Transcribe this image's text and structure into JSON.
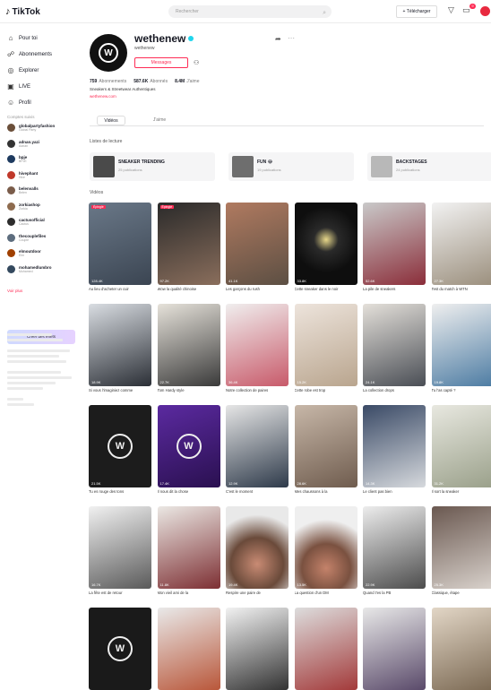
{
  "header": {
    "logo_text": "TikTok",
    "search_placeholder": "Rechercher",
    "upload_label": "+ Télécharger"
  },
  "sidebar": {
    "nav": [
      {
        "label": "Pour toi",
        "icon": "home-icon"
      },
      {
        "label": "Abonnements",
        "icon": "following-icon"
      },
      {
        "label": "Explorer",
        "icon": "compass-icon"
      },
      {
        "label": "LIVE",
        "icon": "live-icon"
      },
      {
        "label": "Profil",
        "icon": "profile-icon"
      }
    ],
    "following_heading": "Comptes suivis",
    "accounts": [
      {
        "name": "globalpartyfashion",
        "sub": "Global Party",
        "color": "#6b4f3a"
      },
      {
        "name": "adnan.yazi",
        "sub": "Adnan",
        "color": "#333"
      },
      {
        "name": "bpje",
        "sub": "BPJE",
        "color": "#1e3a5f"
      },
      {
        "name": "hivephant",
        "sub": "Hive",
        "color": "#c0392b"
      },
      {
        "name": "belenvalls",
        "sub": "Belen",
        "color": "#7a5c4a"
      },
      {
        "name": "zorkiashop",
        "sub": "Zorkia",
        "color": "#8e6b4e"
      },
      {
        "name": "cactusofficial",
        "sub": "Cactus",
        "color": "#2d2d2d"
      },
      {
        "name": "thecouplefiles",
        "sub": "Couple",
        "color": "#5d6d7e"
      },
      {
        "name": "elmoutdoor",
        "sub": "Elm",
        "color": "#a04000"
      },
      {
        "name": "mohamedlumbro",
        "sub": "Mohamed",
        "color": "#34495e"
      }
    ],
    "see_all": "Voir plus",
    "promo_label": "Créer des effets"
  },
  "profile": {
    "username": "wethenew",
    "nickname": "wethenew",
    "message_label": "Messages",
    "stats": [
      {
        "value": "759",
        "label": "Abonnements"
      },
      {
        "value": "587.6K",
        "label": "Abonnés"
      },
      {
        "value": "8.4M",
        "label": "J'aime"
      }
    ],
    "bio": "Sneakers & Streetwear Authentiques",
    "link": "wethenew.com",
    "tabs": {
      "videos": "Vidéos",
      "liked": "J'aime"
    }
  },
  "collections_title": "Listes de lecture",
  "collections": [
    {
      "name": "SNEAKER TRENDING",
      "count": "25 publications",
      "color": "#4a4a4a"
    },
    {
      "name": "FUN 😂",
      "count": "19 publications",
      "color": "#6e6e6e"
    },
    {
      "name": "BACKSTAGES",
      "count": "24 publications",
      "color": "#b8b8b8"
    }
  ],
  "videos_title": "Vidéos",
  "videos": [
    {
      "caption": "Au lieu d'acheter un cuir",
      "views": "128.4K",
      "bg": "linear-gradient(160deg,#6a7888,#3b4552)",
      "pin": "Épinglé",
      "logo": false
    },
    {
      "caption": "Wow la qualité chinoise",
      "views": "97.2K",
      "bg": "linear-gradient(160deg,#2a2a2a,#8a6e5c)",
      "pin": "Épinglé",
      "logo": false
    },
    {
      "caption": "Les garçons du rush",
      "views": "41.1K",
      "bg": "linear-gradient(160deg,#b07a60,#5c4f43)",
      "pin": "",
      "logo": false
    },
    {
      "caption": "Cette sneaker dans le noir",
      "views": "33.8K",
      "bg": "radial-gradient(circle at 50% 45%,#e8d88a 0,#2a2a2a 22%,#0e0e0e 60%)",
      "pin": "",
      "logo": false
    },
    {
      "caption": "La pile de sneakers",
      "views": "52.6K",
      "bg": "linear-gradient(160deg,#c9c9c9,#8b2e3a)",
      "pin": "",
      "logo": false
    },
    {
      "caption": "Test du match à WTN",
      "views": "27.3K",
      "bg": "linear-gradient(160deg,#f2f2f2,#9b8f7d)",
      "pin": "",
      "logo": false
    },
    {
      "caption": "Si vous l'imaginiez comme",
      "views": "18.9K",
      "bg": "linear-gradient(160deg,#d9dde2,#2b2f36)",
      "pin": "",
      "logo": false
    },
    {
      "caption": "Tom Hardy style",
      "views": "22.7K",
      "bg": "linear-gradient(160deg,#e6e2da,#3a3a3a)",
      "pin": "",
      "logo": false
    },
    {
      "caption": "Notre collection de paires",
      "views": "36.4K",
      "bg": "linear-gradient(160deg,#f0eeee,#c85a6a)",
      "pin": "",
      "logo": false
    },
    {
      "caption": "Cette robe est trop",
      "views": "15.2K",
      "bg": "linear-gradient(160deg,#ede4dc,#b9a58e)",
      "pin": "",
      "logo": false
    },
    {
      "caption": "La collection drops",
      "views": "24.1K",
      "bg": "linear-gradient(160deg,#e4e0da,#4a4e55)",
      "pin": "",
      "logo": false
    },
    {
      "caption": "Tu l'as capté ?",
      "views": "19.8K",
      "bg": "linear-gradient(160deg,#efefef,#4d7ca3)",
      "pin": "",
      "logo": false
    },
    {
      "caption": "Tu es rouge des tons",
      "views": "21.5K",
      "bg": "#1c1c1c",
      "pin": "",
      "logo": true
    },
    {
      "caption": "Il nous dit la chose",
      "views": "17.4K",
      "bg": "linear-gradient(160deg,#5b2aa0,#2a1050)",
      "pin": "",
      "logo": true
    },
    {
      "caption": "C'est le moment",
      "views": "12.9K",
      "bg": "linear-gradient(160deg,#e6e6e6,#2e3a4a)",
      "pin": "",
      "logo": false
    },
    {
      "caption": "Mes chaussons à la",
      "views": "28.6K",
      "bg": "linear-gradient(160deg,#c7b7a8,#6f5c4e)",
      "pin": "",
      "logo": false
    },
    {
      "caption": "Le client pas bien",
      "views": "14.3K",
      "bg": "linear-gradient(160deg,#3a4a66,#d6d9dd)",
      "pin": "",
      "logo": false
    },
    {
      "caption": "Il sort la sneaker",
      "views": "31.2K",
      "bg": "linear-gradient(160deg,#e8e8e0,#9aa08a)",
      "pin": "",
      "logo": false
    },
    {
      "caption": "La fête est de retour",
      "views": "16.7K",
      "bg": "linear-gradient(160deg,#f1f1f1,#5a5a5a)",
      "pin": "",
      "logo": false
    },
    {
      "caption": "Mon vieil ami de la",
      "views": "11.8K",
      "bg": "linear-gradient(160deg,#ebe8e4,#7d2f33)",
      "pin": "",
      "logo": false
    },
    {
      "caption": "Respire une paire de",
      "views": "19.4K",
      "bg": "radial-gradient(circle at 50% 70%,#c98b74 0,#6a4a3a 40%,#e9e9e9 75%)",
      "pin": "",
      "logo": false
    },
    {
      "caption": "La question d'un DM",
      "views": "13.5K",
      "bg": "radial-gradient(circle at 50% 75%,#c4826a 0,#7a5140 35%,#efefef 70%)",
      "pin": "",
      "logo": false
    },
    {
      "caption": "Quand t'es la PB",
      "views": "22.9K",
      "bg": "linear-gradient(160deg,#ededed,#4c4c4c)",
      "pin": "",
      "logo": false
    },
    {
      "caption": "Classique, étape",
      "views": "25.3K",
      "bg": "linear-gradient(160deg,#6a5850,#d9d2cc)",
      "pin": "",
      "logo": false
    },
    {
      "caption": "",
      "views": "",
      "bg": "#1a1a1a",
      "pin": "",
      "logo": true
    },
    {
      "caption": "",
      "views": "",
      "bg": "linear-gradient(160deg,#e9e9e9,#b9573a)",
      "pin": "",
      "logo": false
    },
    {
      "caption": "",
      "views": "",
      "bg": "linear-gradient(160deg,#f2f2f2,#333)",
      "pin": "",
      "logo": false
    },
    {
      "caption": "",
      "views": "",
      "bg": "linear-gradient(160deg,#ddd,#a33a3a)",
      "pin": "",
      "logo": false
    },
    {
      "caption": "",
      "views": "",
      "bg": "linear-gradient(160deg,#e8e8e8,#5a4a6a)",
      "pin": "",
      "logo": false
    },
    {
      "caption": "",
      "views": "",
      "bg": "linear-gradient(160deg,#e2d6c6,#7c6a54)",
      "pin": "",
      "logo": false
    }
  ]
}
